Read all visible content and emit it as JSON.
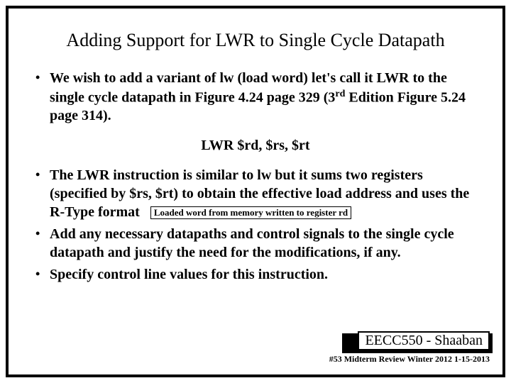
{
  "title": "Adding Support for LWR to Single Cycle Datapath",
  "bullets": {
    "b1_pre": "We wish to add  a variant of lw (load word)  let's call it LWR to the single cycle datapath in Figure 4.24 page 329 (3",
    "b1_sup": "rd",
    "b1_post": " Edition Figure 5.24 page 314)."
  },
  "syntax": "LWR   $rd, $rs,  $rt",
  "bullets2": {
    "b2_text": "The LWR instruction is similar to lw but it sums two registers (specified by $rs, $rt) to obtain the effective load address and uses the R-Type format",
    "b2_box": "Loaded word from memory written to register rd",
    "b3": "Add any necessary datapaths and control signals to the single cycle datapath and justify the need for the modifications, if any.",
    "b4": "Specify control line values for this instruction."
  },
  "footer": {
    "course": "EECC550 - Shaaban",
    "meta": "#53   Midterm Review   Winter 2012  1-15-2013"
  }
}
